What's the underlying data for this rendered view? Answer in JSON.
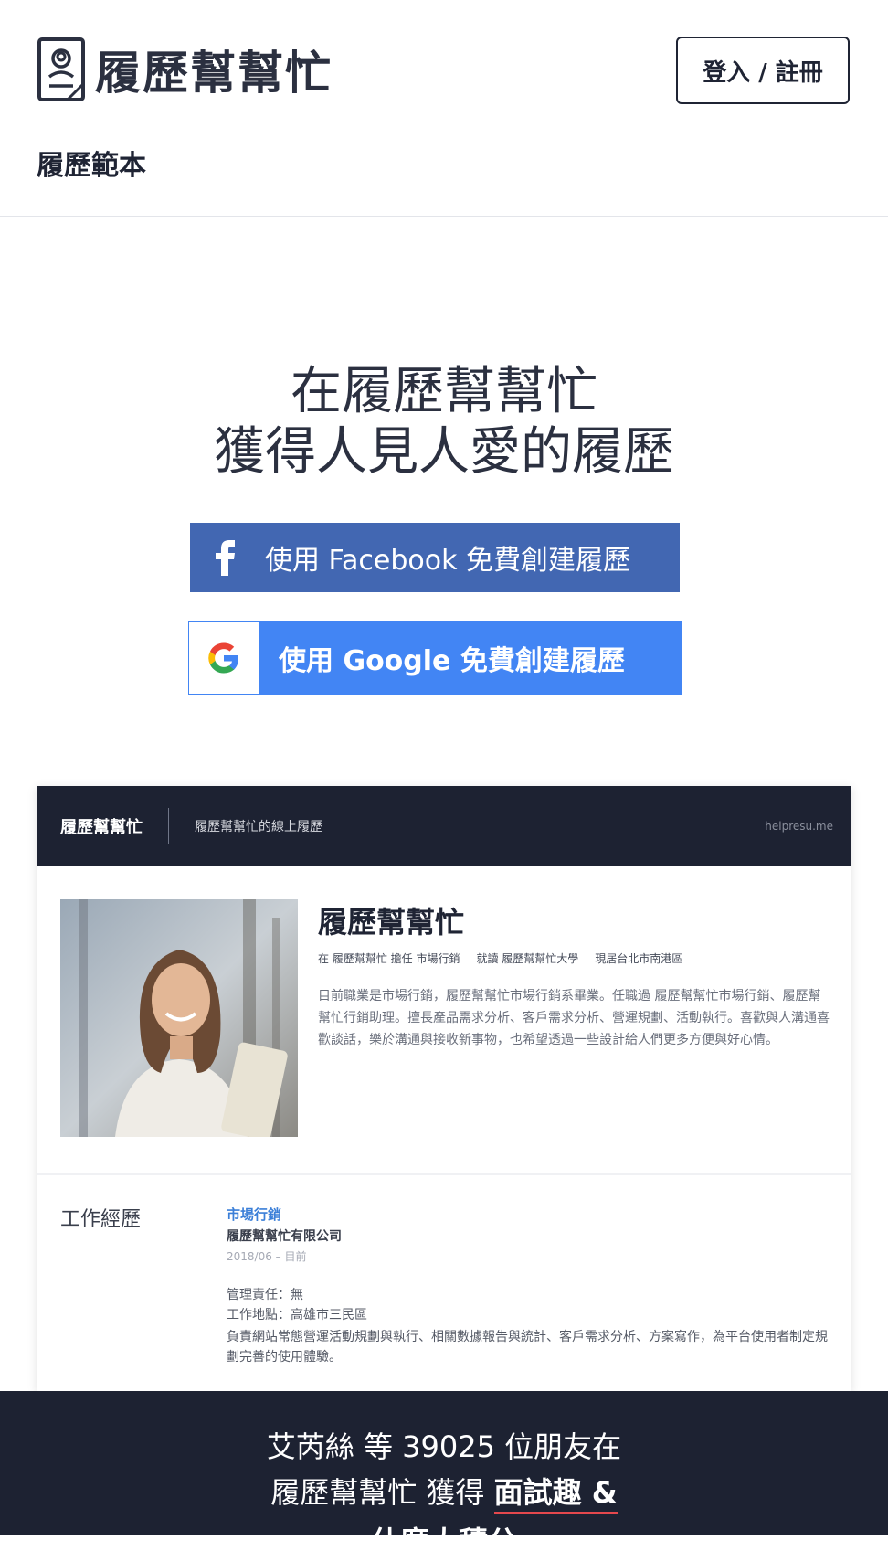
{
  "header": {
    "logo_text": "履歷幫幫忙",
    "login_label": "登入 / 註冊",
    "nav_link": "履歷範本"
  },
  "hero": {
    "title_line1": "在履歷幫幫忙",
    "title_line2": "獲得人見人愛的履歷",
    "facebook_button": "使用 Facebook 免費創建履歷",
    "google_button": "使用 Google 免費創建履歷"
  },
  "preview": {
    "brand": "履歷幫幫忙",
    "subtitle": "履歷幫幫忙的線上履歷",
    "url": "helpresu.me",
    "name": "履歷幫幫忙",
    "meta": [
      "在 履歷幫幫忙 擔任 市場行銷",
      "就讀 履歷幫幫忙大學",
      "現居台北市南港區"
    ],
    "bio": "目前職業是市場行銷，履歷幫幫忙市場行銷系畢業。任職過 履歷幫幫忙市場行銷、履歷幫幫忙行銷助理。擅長產品需求分析、客戶需求分析、營運規劃、活動執行。喜歡與人溝通喜歡談話，樂於溝通與接收新事物，也希望透過一些設計給人們更多方便與好心情。",
    "section_title": "工作經歷",
    "job_title": "市場行銷",
    "company": "履歷幫幫忙有限公司",
    "date": "2018/06 – 目前",
    "management": "管理責任：無",
    "location": "工作地點：高雄市三民區",
    "description": "負責網站常態營運活動規劃與執行、相關數據報告與統計、客戶需求分析、方案寫作，為平台使用者制定規劃完善的使用體驗。"
  },
  "footer": {
    "stat_line1": "艾芮絲  等 39025 位朋友在",
    "stat_line2_prefix": "履歷幫幫忙 獲得 ",
    "stat_highlight": "面試趣 &",
    "stat_line3": "什麼大積分"
  },
  "colors": {
    "facebook": "#4267b2",
    "google": "#4285f4",
    "dark": "#1d2232",
    "accent_red": "#e5484d"
  }
}
